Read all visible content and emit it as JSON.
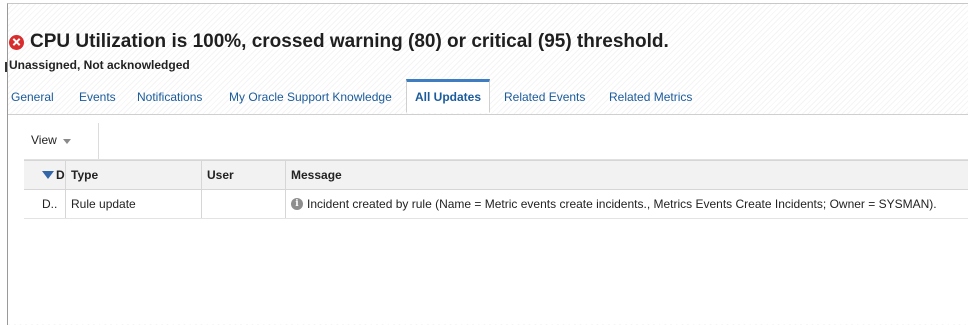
{
  "header": {
    "status_icon": "error-circle-x-icon",
    "status_color": "#d92c2c",
    "title": "CPU Utilization is 100%, crossed warning (80) or critical (95) threshold.",
    "subtitle": "Unassigned, Not acknowledged"
  },
  "tabs": [
    {
      "label": "General",
      "active": false
    },
    {
      "label": "Events",
      "active": false
    },
    {
      "label": "Notifications",
      "active": false
    },
    {
      "label": "My Oracle Support Knowledge",
      "active": false
    },
    {
      "label": "All Updates",
      "active": true
    },
    {
      "label": "Related Events",
      "active": false
    },
    {
      "label": "Related Metrics",
      "active": false
    }
  ],
  "toolbar": {
    "view_label": "View"
  },
  "table": {
    "columns": {
      "date": "Da",
      "type": "Type",
      "user": "User",
      "message": "Message"
    },
    "rows": [
      {
        "date": "D..",
        "type": "Rule update",
        "user": "",
        "message_icon": "info-icon",
        "message": "Incident created by rule (Name = Metric events create incidents., Metrics Events Create Incidents; Owner = SYSMAN)."
      }
    ]
  },
  "colors": {
    "accent": "#3e7dc2",
    "link": "#1a5b9b",
    "error": "#d92c2c"
  }
}
